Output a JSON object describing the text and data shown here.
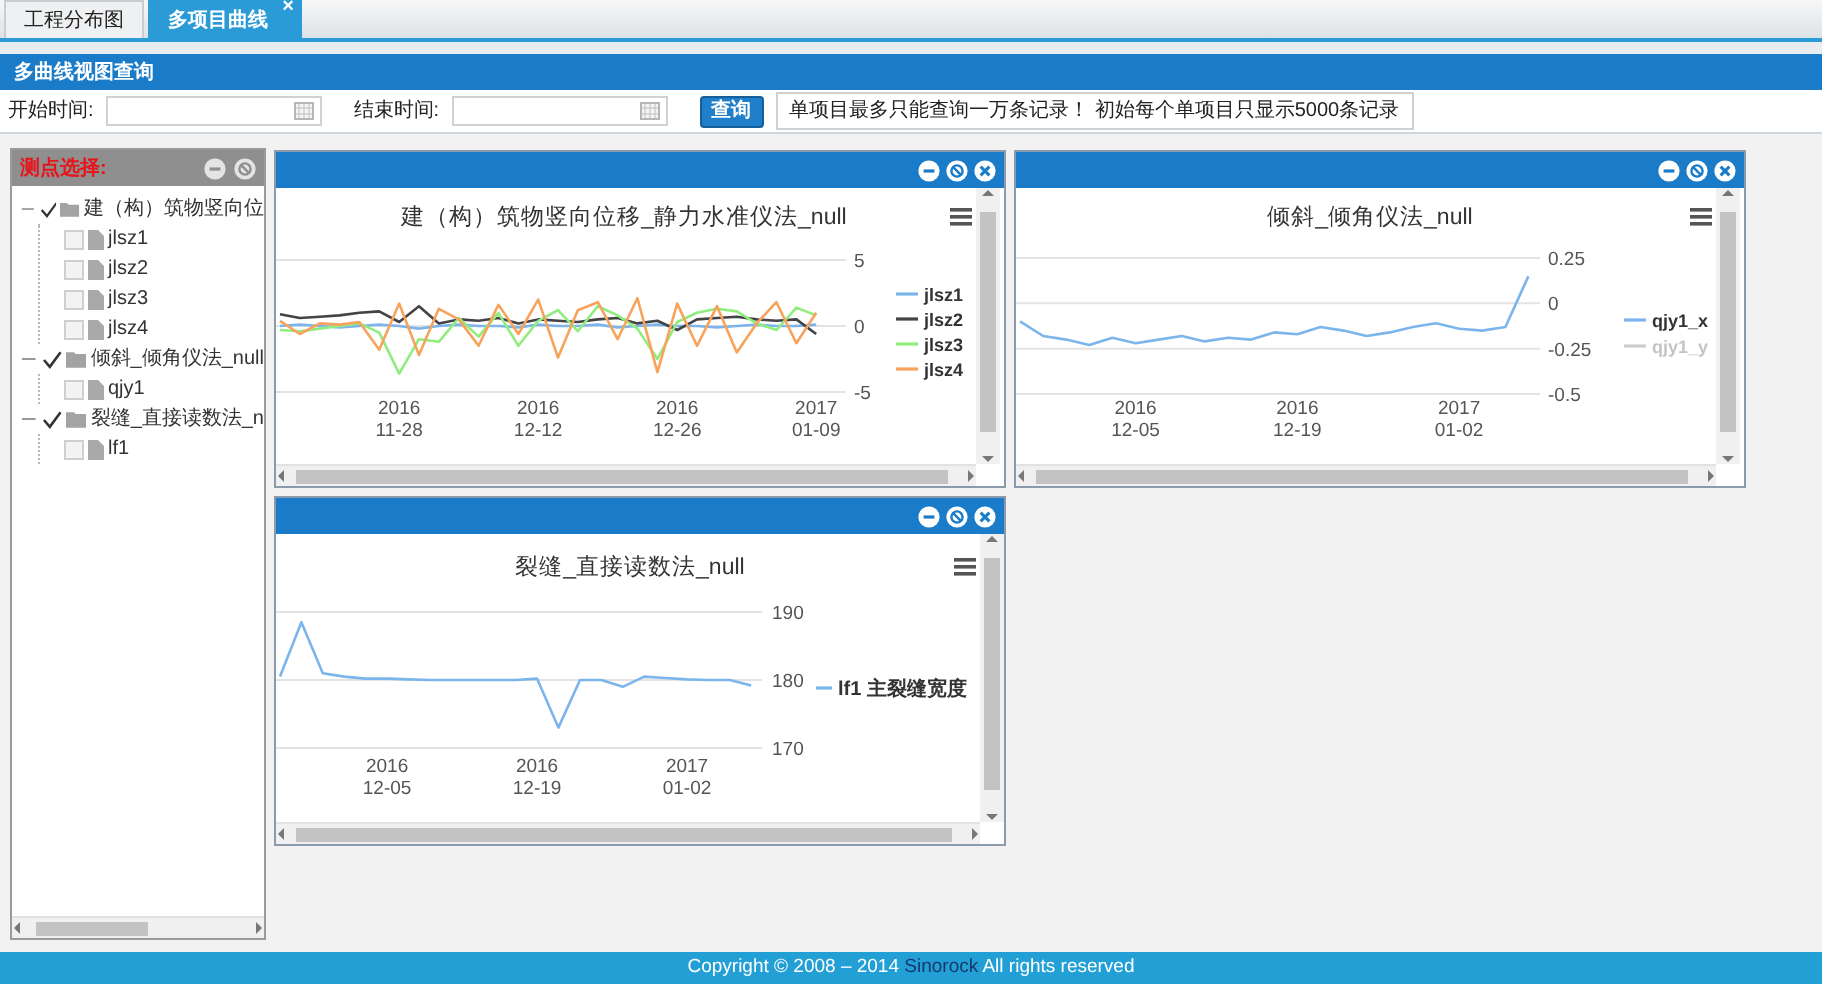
{
  "tabs": [
    {
      "label": "工程分布图",
      "selected": false
    },
    {
      "label": "多项目曲线",
      "selected": true,
      "close_label": "×"
    }
  ],
  "panel_title": "多曲线视图查询",
  "query": {
    "start_label": "开始时间:",
    "end_label": "结束时间:",
    "button": "查询",
    "notice": "单项目最多只能查询一万条记录！  初始每个单项目只显示5000条记录"
  },
  "tree_panel": {
    "title": "测点选择:",
    "items": [
      {
        "label": "建（构）筑物竖向位",
        "checked": true,
        "expanded": true,
        "children": [
          {
            "label": "jlsz1",
            "checked": false
          },
          {
            "label": "jlsz2",
            "checked": false
          },
          {
            "label": "jlsz3",
            "checked": false
          },
          {
            "label": "jlsz4",
            "checked": false
          }
        ]
      },
      {
        "label": "倾斜_倾角仪法_null",
        "checked": true,
        "expanded": true,
        "children": [
          {
            "label": "qjy1",
            "checked": false
          }
        ]
      },
      {
        "label": "裂缝_直接读数法_n",
        "checked": true,
        "expanded": true,
        "children": [
          {
            "label": "lf1",
            "checked": false
          }
        ]
      }
    ]
  },
  "chart_windows": [
    {
      "chart_data": {
        "type": "line",
        "title": "建（构）筑物竖向位移_静力水准仪法_null",
        "legend": true,
        "categories": [
          null,
          null,
          null,
          null,
          null,
          null,
          "2016\n11-28",
          null,
          null,
          null,
          null,
          null,
          null,
          "2016\n12-12",
          null,
          null,
          null,
          null,
          null,
          null,
          "2016\n12-26",
          null,
          null,
          null,
          null,
          null,
          null,
          "2017\n01-09"
        ],
        "ylim": [
          -5,
          5
        ],
        "yticks": [
          5,
          0,
          -5
        ],
        "series": [
          {
            "name": "jlsz1",
            "color": "#7cb5ec",
            "values": [
              0,
              0.1,
              0,
              -0.1,
              0,
              0.1,
              0,
              -0.2,
              0,
              0.1,
              0,
              0,
              -0.1,
              0.1,
              0,
              0,
              0.1,
              -0.1,
              0,
              0.1,
              0,
              0,
              -0.1,
              0,
              0.1,
              0,
              0,
              0.1
            ]
          },
          {
            "name": "jlsz2",
            "color": "#434348",
            "values": [
              0.9,
              0.6,
              0.7,
              0.8,
              1.0,
              1.1,
              0.3,
              1.5,
              0.2,
              0.5,
              0.4,
              0.6,
              0.2,
              0.5,
              0.4,
              0.3,
              0.5,
              0.6,
              0.2,
              0.4,
              -0.3,
              0.5,
              0.6,
              0.7,
              0.5,
              0.4,
              0.5,
              -0.6
            ]
          },
          {
            "name": "jlsz3",
            "color": "#90ed7d",
            "values": [
              -0.3,
              -0.4,
              -0.2,
              0,
              0.2,
              -0.5,
              -3.6,
              -1.0,
              -1.2,
              0.6,
              -0.8,
              1.0,
              -1.5,
              0.4,
              1.2,
              -0.4,
              1.5,
              0.8,
              -0.2,
              -2.5,
              0.3,
              1.0,
              1.3,
              1.1,
              0.2,
              -0.3,
              1.4,
              0.8
            ]
          },
          {
            "name": "jlsz4",
            "color": "#f7a35c",
            "values": [
              0.4,
              -0.6,
              0.2,
              0.1,
              0.3,
              -1.8,
              1.7,
              -2.2,
              1.3,
              0.5,
              -1.5,
              1.6,
              -0.6,
              2.0,
              -2.4,
              1.2,
              1.8,
              -1.0,
              2.1,
              -3.5,
              1.7,
              -1.5,
              1.5,
              -2.0,
              0.2,
              1.8,
              -1.3,
              1.0
            ]
          }
        ]
      }
    },
    {
      "chart_data": {
        "type": "line",
        "title": "倾斜_倾角仪法_null",
        "legend": true,
        "categories": [
          null,
          null,
          null,
          null,
          null,
          "2016\n12-05",
          null,
          null,
          null,
          null,
          null,
          null,
          "2016\n12-19",
          null,
          null,
          null,
          null,
          null,
          null,
          "2017\n01-02",
          null,
          null,
          null
        ],
        "ylim": [
          -0.5,
          0.25
        ],
        "yticks": [
          0.25,
          0,
          -0.25,
          -0.5
        ],
        "series": [
          {
            "name": "qjy1_x",
            "color": "#7cb5ec",
            "values": [
              -0.1,
              -0.18,
              -0.2,
              -0.23,
              -0.19,
              -0.22,
              -0.2,
              -0.18,
              -0.21,
              -0.19,
              -0.2,
              -0.16,
              -0.17,
              -0.13,
              -0.15,
              -0.18,
              -0.16,
              -0.13,
              -0.11,
              -0.14,
              -0.15,
              -0.13,
              0.15
            ]
          },
          {
            "name": "qjy1_y",
            "color": "#cccccc",
            "values": [
              null,
              null,
              null,
              null,
              null,
              null,
              null,
              null,
              null,
              null,
              null,
              null,
              null,
              null,
              null,
              null,
              null,
              null,
              null,
              null,
              null,
              null,
              null
            ]
          }
        ]
      }
    },
    {
      "chart_data": {
        "type": "line",
        "title": "裂缝_直接读数法_null",
        "legend": true,
        "categories": [
          null,
          null,
          null,
          null,
          null,
          "2016\n12-05",
          null,
          null,
          null,
          null,
          null,
          null,
          "2016\n12-19",
          null,
          null,
          null,
          null,
          null,
          null,
          "2017\n01-02",
          null,
          null,
          null
        ],
        "ylim": [
          170,
          190
        ],
        "yticks": [
          190,
          180,
          170
        ],
        "series": [
          {
            "name": "lf1 主裂缝宽度",
            "color": "#7cb5ec",
            "values": [
              180.5,
              188.5,
              181,
              180.5,
              180.2,
              180.2,
              180.1,
              180,
              180,
              180,
              180,
              180,
              180.2,
              173,
              180,
              180,
              179,
              180.5,
              180.3,
              180.1,
              180,
              180,
              179.2
            ]
          }
        ]
      }
    }
  ],
  "footer": {
    "before": "Copyright © 2008 – 2014 ",
    "brand": "Sinorock",
    "after": " All rights reserved"
  }
}
